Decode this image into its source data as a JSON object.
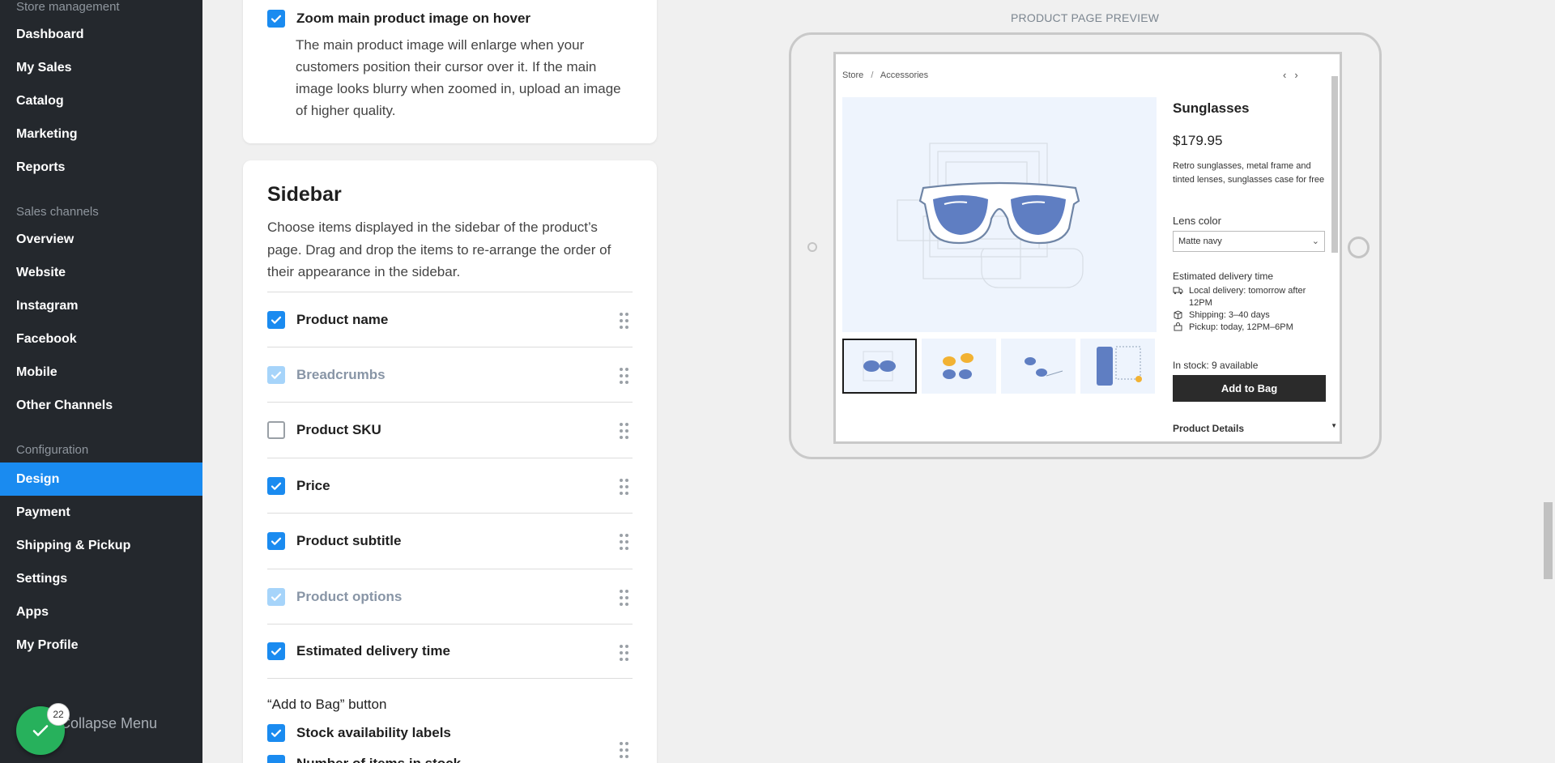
{
  "sidebar": {
    "sections": [
      {
        "title": "Store management",
        "items": [
          "Dashboard",
          "My Sales",
          "Catalog",
          "Marketing",
          "Reports"
        ]
      },
      {
        "title": "Sales channels",
        "items": [
          "Overview",
          "Website",
          "Instagram",
          "Facebook",
          "Mobile",
          "Other Channels"
        ]
      },
      {
        "title": "Configuration",
        "items": [
          "Design",
          "Payment",
          "Shipping & Pickup",
          "Settings",
          "Apps",
          "My Profile"
        ]
      }
    ],
    "active_item": "Design",
    "collapse_label": "Collapse Menu",
    "notification_count": "22"
  },
  "zoom_option": {
    "title": "Zoom main product image on hover",
    "checked": true,
    "description": "The main product image will enlarge when your customers position their cursor over it. If the main image looks blurry when zoomed in, upload an image of higher quality."
  },
  "sidebar_settings": {
    "title": "Sidebar",
    "description": "Choose items displayed in the sidebar of the product’s page. Drag and drop the items to re-arrange the order of their appearance in the sidebar.",
    "items": [
      {
        "label": "Product name",
        "state": "on"
      },
      {
        "label": "Breadcrumbs",
        "state": "dis"
      },
      {
        "label": "Product SKU",
        "state": "off"
      },
      {
        "label": "Price",
        "state": "on"
      },
      {
        "label": "Product subtitle",
        "state": "on"
      },
      {
        "label": "Product options",
        "state": "dis"
      },
      {
        "label": "Estimated delivery time",
        "state": "on"
      }
    ],
    "add_to_bag_heading": "“Add to Bag” button",
    "stock_labels": "Stock availability labels",
    "next_item_partial": "Number of items in stock"
  },
  "preview": {
    "label": "PRODUCT PAGE PREVIEW",
    "breadcrumb": [
      "Store",
      "Accessories"
    ],
    "breadcrumb_sep": "/",
    "product_name": "Sunglasses",
    "price": "$179.95",
    "description": "Retro sunglasses, metal frame and tinted lenses, sunglasses case for free",
    "lens_color_label": "Lens color",
    "lens_color_value": "Matte navy",
    "delivery_title": "Estimated delivery time",
    "delivery": [
      {
        "icon": "truck-icon",
        "text": "Local delivery: tomorrow after 12PM"
      },
      {
        "icon": "box-icon",
        "text": "Shipping: 3–40 days"
      },
      {
        "icon": "bag-icon",
        "text": "Pickup: today, 12PM–6PM"
      }
    ],
    "stock": "In stock: 9 available",
    "add_to_bag": "Add to Bag",
    "details_heading": "Product Details"
  },
  "colors": {
    "accent": "#1a8bf0",
    "sidebar_bg": "#24282d",
    "fab": "#27b15c",
    "lens": "#5f7ec2"
  }
}
